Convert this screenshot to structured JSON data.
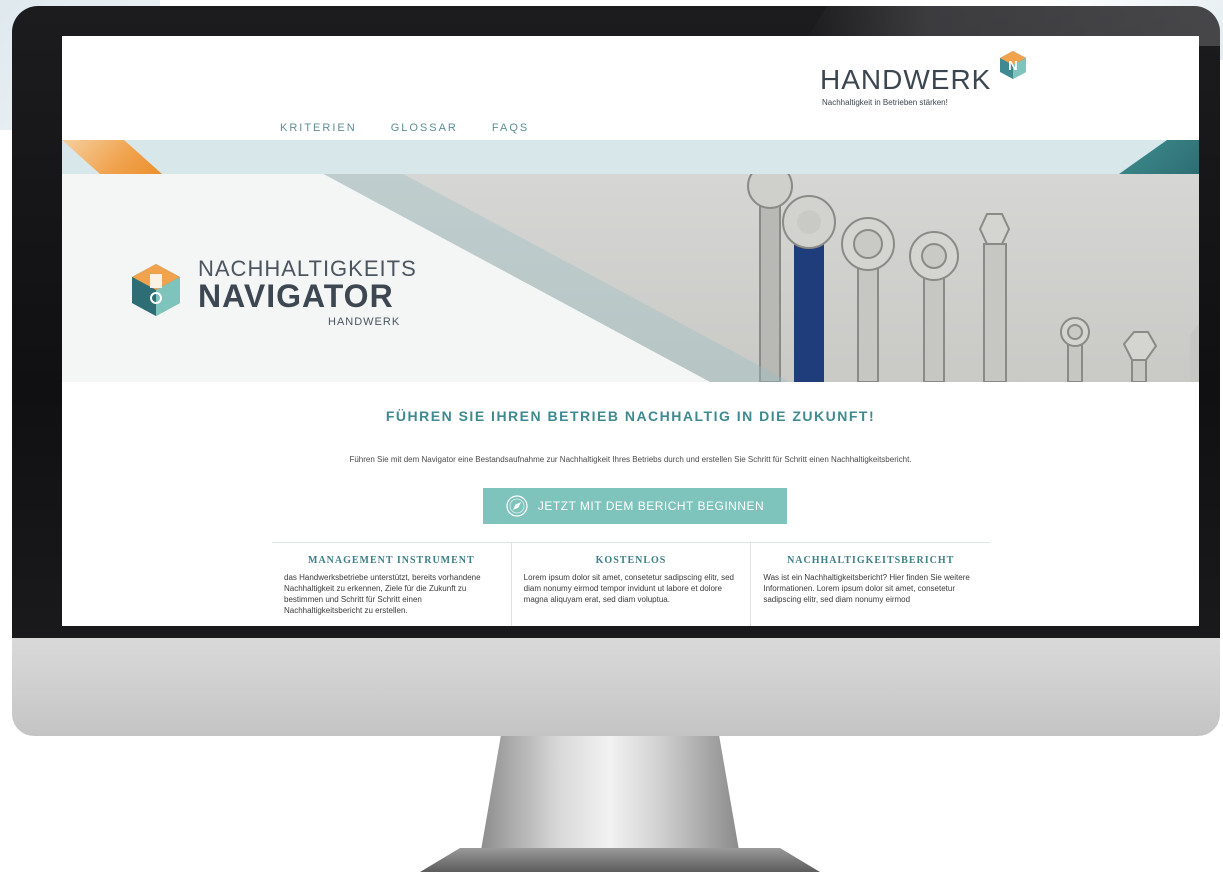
{
  "brand": {
    "name": "HANDWERK",
    "tagline": "Nachhaltigkeit in Betrieben stärken!"
  },
  "nav": {
    "items": [
      "KRITERIEN",
      "GLOSSAR",
      "FAQS"
    ]
  },
  "hero": {
    "logo_line1": "NACHHALTIGKEITS",
    "logo_line2": "NAVIGATOR",
    "logo_line3": "HANDWERK"
  },
  "main": {
    "headline": "FÜHREN SIE IHREN BETRIEB NACHHALTIG IN DIE ZUKUNFT!",
    "intro": "Führen Sie mit dem Navigator eine Bestandsaufnahme zur Nachhaltigkeit Ihres Betriebs durch und erstellen Sie Schritt für Schritt einen Nachhaltigkeitsbericht.",
    "cta_label": "JETZT MIT DEM BERICHT BEGINNEN"
  },
  "features": [
    {
      "title": "MANAGEMENT INSTRUMENT",
      "text": "das Handwerksbetriebe unterstützt, bereits vorhandene Nachhaltigkeit zu erkennen, Ziele für die Zukunft zu bestimmen und Schritt für Schritt einen Nachhaltigkeitsbericht zu erstellen."
    },
    {
      "title": "KOSTENLOS",
      "text": "Lorem ipsum dolor sit amet, consetetur sadipscing elitr, sed diam nonumy eirmod tempor invidunt ut labore et dolore magna aliquyam erat, sed diam voluptua."
    },
    {
      "title": "NACHHALTIGKEITSBERICHT",
      "text": "Was ist ein Nachhaltigkeitsbericht? Hier finden Sie weitere Informationen. Lorem ipsum dolor sit amet, consetetur sadipscing elitr, sed diam nonumy eirmod"
    }
  ],
  "colors": {
    "accent_teal": "#3f8a91",
    "button_teal": "#7fc4bc",
    "stripe_orange": "#f0a24c",
    "monitor_bezel": "#141416"
  }
}
